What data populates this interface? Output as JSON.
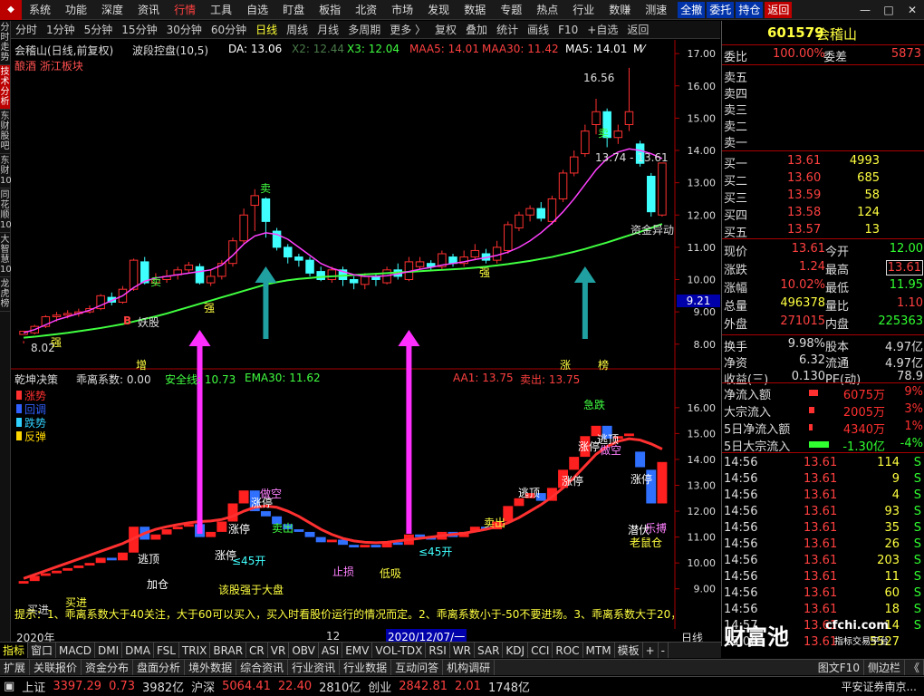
{
  "menu": {
    "items": [
      "系统",
      "功能",
      "深度",
      "资讯",
      "行情",
      "工具",
      "自选",
      "盯盘",
      "板指",
      "北资",
      "市场",
      "发现",
      "数据",
      "专题",
      "热点",
      "行业",
      "数赚",
      "测速"
    ],
    "active": "行情",
    "buttons": [
      "全撤",
      "委托",
      "持仓",
      "返回"
    ]
  },
  "periods": {
    "items": [
      "分时",
      "1分钟",
      "5分钟",
      "15分钟",
      "30分钟",
      "60分钟",
      "日线",
      "周线",
      "月线",
      "多周期",
      "更多 〉",
      "复权",
      "叠加",
      "统计",
      "画线",
      "F10",
      "+自选",
      "返回"
    ],
    "active": "日线"
  },
  "left_tabs": [
    "分时走势",
    "技术分析",
    "东财股吧",
    "东财10",
    "同花顺10",
    "大智慧10",
    "龙虎榜"
  ],
  "left_tabs_active": "技术分析",
  "main": {
    "title": "会稽山(日线,前复权)",
    "sector": "酿酒 浙江板块",
    "indicator": "波段控盘(10,5)",
    "da": "DA: 13.06",
    "x2": "X2: 12.44",
    "x3": "X3: 12.04",
    "maa5": "MAA5: 14.01",
    "maa30": "MAA30: 11.42",
    "ma5": "MA5: 14.01",
    "ma_more": "M⁄"
  },
  "price_axis": [
    "17.00",
    "16.00",
    "15.00",
    "14.00",
    "13.00",
    "12.00",
    "11.00",
    "10.00",
    "9.00",
    "8.00"
  ],
  "cursor_price": "9.21",
  "labels_main": {
    "high": "16.56",
    "range": "13.74 - 13.61",
    "low": "8.02",
    "fund": "资金异动",
    "yaogu": "妖股",
    "qiang1": "强",
    "qiang2": "强",
    "qiang3": "强",
    "mai1": "卖",
    "mai2": "卖",
    "mai3": "卖",
    "zeng": "增",
    "zhang": "涨",
    "bang": "榜",
    "b": "B"
  },
  "sub": {
    "title": "乾坤决策",
    "coef": "乖离系数: 0.00",
    "safe": "安全线: 10.73",
    "ema30": "EMA30: 11.62",
    "aa1": "AA1: 13.75",
    "sell": "卖出: 13.75",
    "legend": [
      "涨势",
      "回调",
      "跌势",
      "反弹"
    ],
    "legend_colors": [
      "#ff3030",
      "#3060ff",
      "#30d0ff",
      "#ffd700"
    ]
  },
  "sub_axis": [
    "16.00",
    "15.00",
    "14.00",
    "13.00",
    "12.00",
    "11.00",
    "10.00",
    "9.00"
  ],
  "labels_sub": {
    "zt1": "涨停",
    "zt2": "涨停",
    "zt3": "涨停",
    "zt4": "涨停",
    "zt5": "涨停",
    "zt6": "涨停",
    "tiaoding1": "逃顶",
    "tiaoding2": "逃顶",
    "tiaoding3": "逃顶",
    "jixian": "急跌",
    "maichu": "卖出",
    "mairu": "买进",
    "zhizhi": "止损",
    "dixi": "低吸",
    "jjyz": "该股强于大盘",
    "zuida": "做空",
    "laoshu": "老鼠仓",
    "qianfu": "潜伏",
    "kaigao": "≤45开",
    "kaigao2": "≤45开",
    "kaigao3": "≤45开",
    "jia": "加仓",
    "jiaocha": "乐搏"
  },
  "desc": "提示：1、乖离系数大于40关注，大于60可以买入，买入时看股价运行的情况而定。2、乖离系数小于-50不要进场。3、乖离系数大于20，",
  "time_axis": {
    "year": "2020年",
    "m12": "12",
    "cursor_date": "2020/12/07/一",
    "daily": "日线"
  },
  "bottom_tabs": [
    "指标",
    "窗口",
    "MACD",
    "DMI",
    "DMA",
    "FSL",
    "TRIX",
    "BRAR",
    "CR",
    "VR",
    "OBV",
    "ASI",
    "EMV",
    "VOL-TDX",
    "RSI",
    "WR",
    "SAR",
    "KDJ",
    "CCI",
    "ROC",
    "MTM",
    "模板",
    "+",
    "-"
  ],
  "func_tabs": [
    "扩展",
    "关联报价",
    "资金分布",
    "盘面分析",
    "境外数据",
    "综合资讯",
    "行业资讯",
    "行业数据",
    "互动问答",
    "机构调研"
  ],
  "func_right": [
    "图文F10",
    "侧边栏",
    "《"
  ],
  "watermark": {
    "brand": "财富池",
    "site": "cfchi.com",
    "sub": "指标交易平台"
  },
  "ticker": {
    "sh_name": "上证",
    "sh_val": "3397.29",
    "sh_chg": "0.73",
    "sh_amt": "3982亿",
    "sz_name": "沪深",
    "sz_val": "5064.41",
    "sz_chg": "22.40",
    "sz_amt": "2810亿",
    "cy_name": "创业",
    "cy_val": "2842.81",
    "cy_chg": "2.01",
    "cy_amt": "1748亿",
    "broker": "平安证券南京..."
  },
  "quote": {
    "code": "601579",
    "name": "会稽山",
    "weibi_label": "委比",
    "weibi": "100.00%",
    "weicha_label": "委差",
    "weicha": "5873",
    "sell": [
      {
        "label": "卖五",
        "price": "",
        "vol": ""
      },
      {
        "label": "卖四",
        "price": "",
        "vol": ""
      },
      {
        "label": "卖三",
        "price": "",
        "vol": ""
      },
      {
        "label": "卖二",
        "price": "",
        "vol": ""
      },
      {
        "label": "卖一",
        "price": "",
        "vol": ""
      }
    ],
    "buy": [
      {
        "label": "买一",
        "price": "13.61",
        "vol": "4993"
      },
      {
        "label": "买二",
        "price": "13.60",
        "vol": "685"
      },
      {
        "label": "买三",
        "price": "13.59",
        "vol": "58"
      },
      {
        "label": "买四",
        "price": "13.58",
        "vol": "124"
      },
      {
        "label": "买五",
        "price": "13.57",
        "vol": "13"
      }
    ],
    "stats": [
      {
        "l1": "现价",
        "v1": "13.61",
        "l2": "今开",
        "v2": "12.00",
        "c1": "#ff4040",
        "c2": "#30ff30"
      },
      {
        "l1": "涨跌",
        "v1": "1.24",
        "l2": "最高",
        "v2": "13.61",
        "c1": "#ff4040",
        "c2": "#ff4040"
      },
      {
        "l1": "涨幅",
        "v1": "10.02%",
        "l2": "最低",
        "v2": "11.95",
        "c1": "#ff4040",
        "c2": "#30ff30"
      },
      {
        "l1": "总量",
        "v1": "496378",
        "l2": "量比",
        "v2": "1.10",
        "c1": "#ffff40",
        "c2": "#ff4040"
      },
      {
        "l1": "外盘",
        "v1": "271015",
        "l2": "内盘",
        "v2": "225363",
        "c1": "#ff4040",
        "c2": "#30ff30"
      }
    ],
    "stats2": [
      {
        "l1": "换手",
        "v1": "9.98%",
        "l2": "股本",
        "v2": "4.97亿"
      },
      {
        "l1": "净资",
        "v1": "6.32",
        "l2": "流通",
        "v2": "4.97亿"
      },
      {
        "l1": "收益(三)",
        "v1": "0.130",
        "l2": "PE(动)",
        "v2": "78.9"
      }
    ],
    "flows": [
      {
        "label": "净流入额",
        "val": "6075万",
        "pct": "9%",
        "color": "#ff3030",
        "barw": 10
      },
      {
        "label": "大宗流入",
        "val": "2005万",
        "pct": "3%",
        "color": "#ff3030",
        "barw": 6
      },
      {
        "label": "5日净流入额",
        "val": "4340万",
        "pct": "1%",
        "color": "#ff3030",
        "barw": 4
      },
      {
        "label": "5日大宗流入",
        "val": "-1.30亿",
        "pct": "-4%",
        "color": "#30ff30",
        "barw": 22
      }
    ],
    "ticks": [
      {
        "t": "14:56",
        "p": "13.61",
        "v": "114",
        "s": "S"
      },
      {
        "t": "14:56",
        "p": "13.61",
        "v": "9",
        "s": "S"
      },
      {
        "t": "14:56",
        "p": "13.61",
        "v": "4",
        "s": "S"
      },
      {
        "t": "14:56",
        "p": "13.61",
        "v": "93",
        "s": "S"
      },
      {
        "t": "14:56",
        "p": "13.61",
        "v": "35",
        "s": "S"
      },
      {
        "t": "14:56",
        "p": "13.61",
        "v": "26",
        "s": "S"
      },
      {
        "t": "14:56",
        "p": "13.61",
        "v": "203",
        "s": "S"
      },
      {
        "t": "14:56",
        "p": "13.61",
        "v": "11",
        "s": "S"
      },
      {
        "t": "14:56",
        "p": "13.61",
        "v": "60",
        "s": "S"
      },
      {
        "t": "14:56",
        "p": "13.61",
        "v": "18",
        "s": "S"
      },
      {
        "t": "14:57",
        "p": "13.61",
        "v": "14",
        "s": "S"
      },
      {
        "t": "15:00",
        "p": "13.61",
        "v": "5527",
        "s": ""
      }
    ]
  },
  "chart_data": {
    "type": "candlestick",
    "main_ylim": [
      7.6,
      17.2
    ],
    "sub_ylim": [
      8.5,
      16.8
    ],
    "candles": [
      [
        8.3,
        8.4,
        8.1,
        8.02
      ],
      [
        8.35,
        8.55,
        8.3,
        8.6
      ],
      [
        8.55,
        8.85,
        8.5,
        8.9
      ],
      [
        8.85,
        8.9,
        8.7,
        9.0
      ],
      [
        8.9,
        8.95,
        8.8,
        9.05
      ],
      [
        8.95,
        9.0,
        8.85,
        9.1
      ],
      [
        9.0,
        9.1,
        8.95,
        9.2
      ],
      [
        9.1,
        9.5,
        9.05,
        9.55
      ],
      [
        9.45,
        9.3,
        9.2,
        9.6
      ],
      [
        9.3,
        9.7,
        9.25,
        9.8
      ],
      [
        9.7,
        10.6,
        9.65,
        10.65
      ],
      [
        10.55,
        9.9,
        9.85,
        10.7
      ],
      [
        9.9,
        10.0,
        9.8,
        10.2
      ],
      [
        10.0,
        10.1,
        9.9,
        10.3
      ],
      [
        10.15,
        10.3,
        10.0,
        10.4
      ],
      [
        10.3,
        10.45,
        10.2,
        10.55
      ],
      [
        10.4,
        9.9,
        9.85,
        10.5
      ],
      [
        9.9,
        10.1,
        9.8,
        10.3
      ],
      [
        10.1,
        10.5,
        10.0,
        10.6
      ],
      [
        10.5,
        11.2,
        10.4,
        11.3
      ],
      [
        11.2,
        12.0,
        11.1,
        12.2
      ],
      [
        12.3,
        12.6,
        11.5,
        12.8
      ],
      [
        12.5,
        11.8,
        11.3,
        12.55
      ],
      [
        11.5,
        11.0,
        10.9,
        11.6
      ],
      [
        11.0,
        10.7,
        10.5,
        11.1
      ],
      [
        10.7,
        10.6,
        10.4,
        10.8
      ],
      [
        10.6,
        10.2,
        10.1,
        10.7
      ],
      [
        10.25,
        10.0,
        9.95,
        10.4
      ],
      [
        10.0,
        10.3,
        9.9,
        10.4
      ],
      [
        10.3,
        10.0,
        9.8,
        10.4
      ],
      [
        10.0,
        9.9,
        9.7,
        10.1
      ],
      [
        9.85,
        10.1,
        9.7,
        10.2
      ],
      [
        10.1,
        10.0,
        9.8,
        10.2
      ],
      [
        9.9,
        10.3,
        9.85,
        10.4
      ],
      [
        10.3,
        10.1,
        10.0,
        10.5
      ],
      [
        10.0,
        10.55,
        9.95,
        10.7
      ],
      [
        10.4,
        10.55,
        10.3,
        10.7
      ],
      [
        10.5,
        10.4,
        10.3,
        10.6
      ],
      [
        10.4,
        10.8,
        10.3,
        10.9
      ],
      [
        10.7,
        10.5,
        10.4,
        10.8
      ],
      [
        10.5,
        10.7,
        10.4,
        10.9
      ],
      [
        10.7,
        10.9,
        10.6,
        11.1
      ],
      [
        10.8,
        10.6,
        10.5,
        10.95
      ],
      [
        10.6,
        11.0,
        10.5,
        11.2
      ],
      [
        10.9,
        11.7,
        10.8,
        11.8
      ],
      [
        11.6,
        12.0,
        11.5,
        12.1
      ],
      [
        12.0,
        12.2,
        11.8,
        12.3
      ],
      [
        12.2,
        11.9,
        11.8,
        12.4
      ],
      [
        11.8,
        12.5,
        11.7,
        12.6
      ],
      [
        12.5,
        13.3,
        12.4,
        13.4
      ],
      [
        13.3,
        13.8,
        13.2,
        14.0
      ],
      [
        13.9,
        14.6,
        13.8,
        14.8
      ],
      [
        14.8,
        15.2,
        14.5,
        15.6
      ],
      [
        15.2,
        14.4,
        14.1,
        15.3
      ],
      [
        14.4,
        14.6,
        14.2,
        14.8
      ],
      [
        14.8,
        15.2,
        14.6,
        16.56
      ],
      [
        14.2,
        13.6,
        13.5,
        14.3
      ],
      [
        13.2,
        12.1,
        11.95,
        13.3
      ],
      [
        12.0,
        13.61,
        11.95,
        13.61
      ]
    ],
    "ma_fast": [
      8.35,
      8.45,
      8.6,
      8.75,
      8.85,
      8.95,
      9.05,
      9.2,
      9.35,
      9.5,
      9.75,
      9.95,
      10.05,
      10.1,
      10.15,
      10.2,
      10.25,
      10.3,
      10.45,
      10.75,
      11.1,
      11.35,
      11.45,
      11.4,
      11.25,
      11.0,
      10.75,
      10.5,
      10.35,
      10.25,
      10.15,
      10.1,
      10.1,
      10.12,
      10.18,
      10.25,
      10.32,
      10.38,
      10.45,
      10.5,
      10.55,
      10.62,
      10.68,
      10.75,
      10.85,
      11.0,
      11.2,
      11.45,
      11.75,
      12.1,
      12.5,
      12.95,
      13.4,
      13.75,
      13.95,
      14.05,
      14.0,
      13.9,
      13.75
    ],
    "ma_slow": [
      8.2,
      8.23,
      8.27,
      8.31,
      8.35,
      8.4,
      8.45,
      8.5,
      8.56,
      8.62,
      8.7,
      8.78,
      8.86,
      8.95,
      9.05,
      9.15,
      9.25,
      9.35,
      9.45,
      9.55,
      9.65,
      9.75,
      9.85,
      9.92,
      9.98,
      10.02,
      10.05,
      10.08,
      10.1,
      10.12,
      10.14,
      10.16,
      10.18,
      10.2,
      10.22,
      10.24,
      10.26,
      10.28,
      10.3,
      10.32,
      10.34,
      10.37,
      10.4,
      10.44,
      10.48,
      10.53,
      10.58,
      10.64,
      10.7,
      10.78,
      10.86,
      10.95,
      11.05,
      11.15,
      11.26,
      11.37,
      11.48,
      11.6,
      11.72
    ],
    "sub_candles": [
      [
        9.2,
        9.3,
        9.1,
        9.4
      ],
      [
        9.3,
        9.5,
        9.2,
        9.6
      ],
      [
        9.5,
        9.6,
        9.4,
        9.7
      ],
      [
        9.6,
        9.7,
        9.5,
        9.8
      ],
      [
        9.7,
        9.8,
        9.6,
        9.9
      ],
      [
        9.8,
        9.9,
        9.7,
        10.0
      ],
      [
        9.9,
        10.0,
        9.8,
        10.1
      ],
      [
        10.0,
        10.2,
        9.9,
        10.3
      ],
      [
        10.2,
        10.1,
        10.0,
        10.3
      ],
      [
        10.1,
        10.4,
        10.0,
        10.5
      ],
      [
        10.4,
        11.4,
        10.3,
        11.5
      ],
      [
        11.4,
        10.9,
        10.8,
        11.5
      ],
      [
        10.9,
        11.1,
        10.8,
        11.2
      ],
      [
        11.1,
        11.3,
        11.0,
        11.4
      ],
      [
        11.3,
        11.4,
        11.2,
        11.5
      ],
      [
        11.4,
        11.5,
        11.3,
        11.6
      ],
      [
        11.5,
        11.0,
        10.9,
        11.6
      ],
      [
        11.0,
        11.2,
        10.9,
        11.3
      ],
      [
        11.2,
        11.6,
        11.1,
        11.7
      ],
      [
        11.6,
        12.3,
        11.5,
        12.4
      ],
      [
        12.3,
        12.8,
        12.2,
        13.0
      ],
      [
        12.8,
        12.0,
        11.9,
        12.9
      ],
      [
        12.0,
        11.8,
        11.7,
        12.1
      ],
      [
        11.8,
        11.5,
        11.4,
        11.9
      ],
      [
        11.5,
        11.3,
        11.2,
        11.6
      ],
      [
        11.3,
        11.2,
        11.1,
        11.4
      ],
      [
        11.2,
        11.0,
        10.9,
        11.3
      ],
      [
        11.0,
        10.8,
        10.7,
        11.1
      ],
      [
        10.8,
        10.9,
        10.7,
        11.0
      ],
      [
        10.9,
        10.7,
        10.6,
        11.0
      ],
      [
        10.7,
        10.6,
        10.5,
        10.8
      ],
      [
        10.6,
        10.7,
        10.5,
        10.8
      ],
      [
        10.7,
        10.6,
        10.5,
        10.8
      ],
      [
        10.6,
        10.8,
        10.5,
        10.9
      ],
      [
        10.8,
        10.7,
        10.6,
        10.9
      ],
      [
        10.7,
        11.1,
        10.6,
        11.2
      ],
      [
        11.1,
        11.0,
        10.9,
        11.2
      ],
      [
        11.0,
        10.9,
        10.8,
        11.1
      ],
      [
        10.9,
        11.2,
        10.8,
        11.3
      ],
      [
        11.2,
        11.0,
        10.9,
        11.3
      ],
      [
        11.0,
        11.2,
        10.9,
        11.3
      ],
      [
        11.2,
        11.4,
        11.1,
        11.5
      ],
      [
        11.4,
        11.3,
        11.2,
        11.5
      ],
      [
        11.3,
        11.6,
        11.2,
        11.7
      ],
      [
        11.6,
        12.2,
        11.5,
        12.3
      ],
      [
        12.2,
        12.5,
        12.1,
        12.6
      ],
      [
        12.5,
        12.7,
        12.4,
        12.8
      ],
      [
        12.7,
        12.4,
        12.3,
        12.8
      ],
      [
        12.4,
        12.9,
        12.3,
        13.0
      ],
      [
        12.9,
        13.6,
        12.8,
        13.7
      ],
      [
        13.6,
        14.1,
        13.5,
        14.2
      ],
      [
        14.1,
        14.9,
        14.0,
        15.0
      ],
      [
        14.9,
        15.3,
        14.8,
        15.5
      ],
      [
        15.3,
        14.8,
        14.7,
        15.4
      ],
      [
        14.8,
        14.9,
        14.7,
        15.0
      ],
      [
        14.9,
        15.0,
        14.8,
        15.3
      ],
      [
        14.3,
        13.7,
        13.6,
        14.4
      ],
      [
        13.6,
        12.3,
        12.2,
        13.7
      ],
      [
        12.3,
        13.9,
        12.2,
        14.0
      ]
    ],
    "sub_line": [
      9.4,
      9.55,
      9.7,
      9.85,
      10.0,
      10.15,
      10.3,
      10.45,
      10.6,
      10.75,
      10.95,
      11.15,
      11.3,
      11.4,
      11.48,
      11.55,
      11.6,
      11.62,
      11.68,
      11.8,
      12.0,
      12.15,
      12.2,
      12.15,
      12.0,
      11.8,
      11.55,
      11.3,
      11.1,
      10.95,
      10.85,
      10.8,
      10.78,
      10.8,
      10.85,
      10.9,
      10.95,
      11.0,
      11.05,
      11.1,
      11.15,
      11.22,
      11.3,
      11.4,
      11.55,
      11.75,
      12.0,
      12.25,
      12.55,
      12.9,
      13.3,
      13.75,
      14.2,
      14.5,
      14.7,
      14.8,
      14.75,
      14.6,
      14.4
    ],
    "arrows": [
      {
        "type": "magenta",
        "x_index": 16
      },
      {
        "type": "teal",
        "x_index": 22
      },
      {
        "type": "magenta",
        "x_index": 35
      },
      {
        "type": "teal",
        "x_index": 51
      }
    ]
  }
}
